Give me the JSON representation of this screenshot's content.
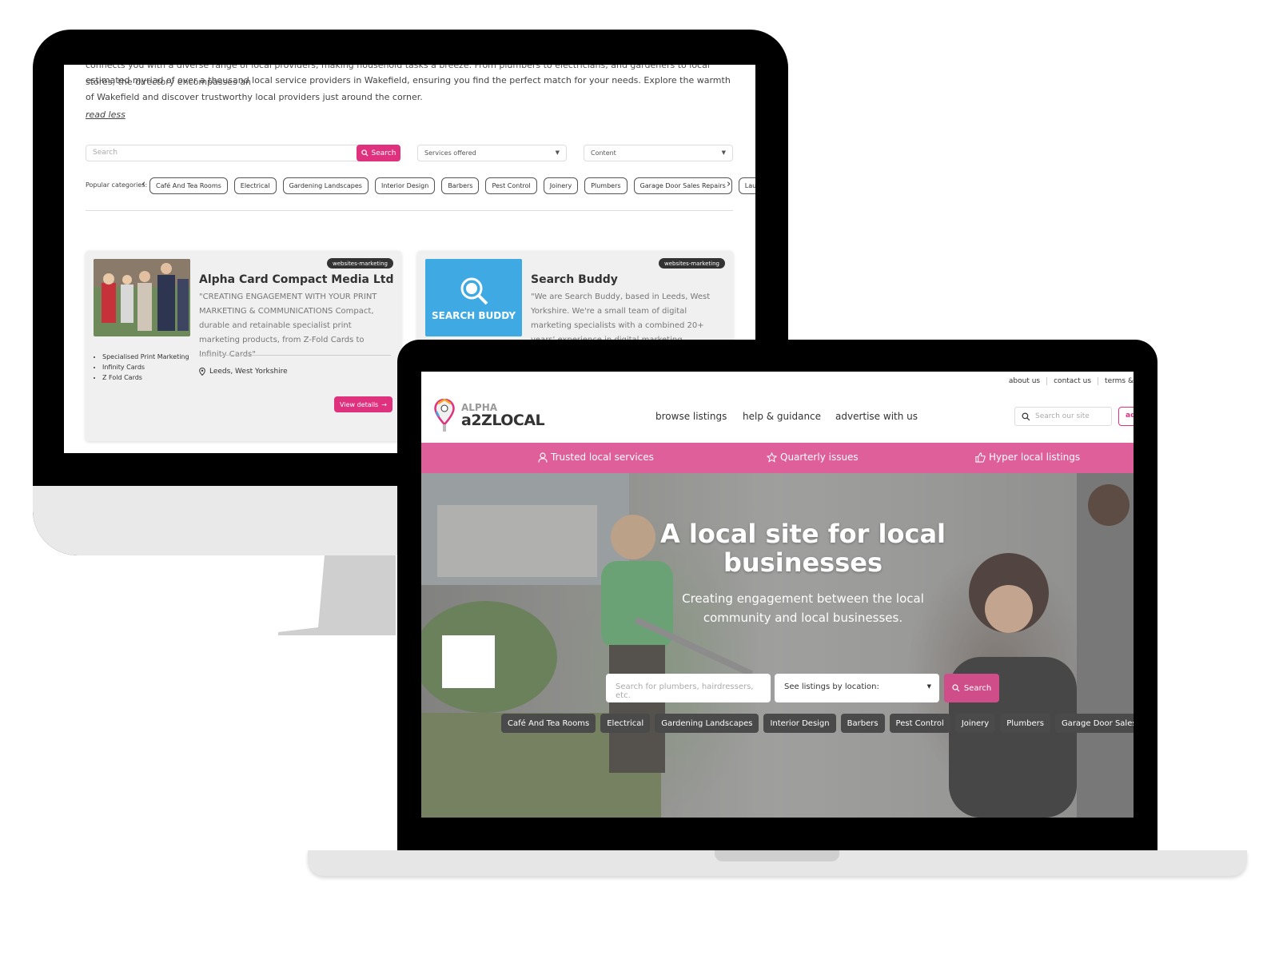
{
  "directory_page": {
    "description_top": "connects you with a diverse range of local providers, making household tasks a breeze. From plumbers to electricians, and gardeners to local stores, the directory encompasses an",
    "description": "estimated myriad of over a thousand local service providers in Wakefield, ensuring you find the perfect match for your needs. Explore the warmth of Wakefield and discover trustworthy local providers just around the corner.",
    "read_less": "read less",
    "search_placeholder": "Search",
    "search_button": "Search",
    "filter_services": "Services offered",
    "filter_content": "Content",
    "popular_label": "Popular categories:",
    "categories": [
      "Café And Tea Rooms",
      "Electrical",
      "Gardening Landscapes",
      "Interior Design",
      "Barbers",
      "Pest Control",
      "Joinery",
      "Plumbers",
      "Garage Door Sales Repairs",
      "Laundry Servi"
    ],
    "listings": [
      {
        "badge": "websites-marketing",
        "title": "Alpha Card Compact Media Ltd",
        "text": "\"CREATING ENGAGEMENT WITH YOUR PRINT MARKETING & COMMUNICATIONS Compact, durable and retainable specialist print marketing products, from Z-Fold Cards to Infinity Cards\"",
        "bullets": [
          "Specialised Print Marketing",
          "Infinity Cards",
          "Z Fold Cards"
        ],
        "location": "Leeds, West Yorkshire",
        "button": "View details"
      },
      {
        "badge": "websites-marketing",
        "title": "Search Buddy",
        "image_label": "SEARCH BUDDY",
        "text": "\"We are Search Buddy, based in Leeds, West Yorkshire. We're a small team of digital marketing specialists with a combined 20+ years' experience in digital marketing."
      }
    ]
  },
  "home_page": {
    "top_links": [
      "about us",
      "contact us",
      "terms &"
    ],
    "logo_small": "ALPHA",
    "logo_big": "a2ZLOCAL",
    "nav": [
      "browse listings",
      "help & guidance",
      "advertise with us"
    ],
    "site_search_placeholder": "Search our site",
    "ad_button": "ad",
    "features": [
      "Trusted local services",
      "Quarterly issues",
      "Hyper local listings"
    ],
    "hero_title": "A local site for local businesses",
    "hero_subtitle": "Creating engagement between the local community and local businesses.",
    "hero_search_placeholder": "Search for plumbers, hairdressers, etc.",
    "location_select": "See listings by location:",
    "hero_search_button": "Search",
    "hero_categories": [
      "Café And Tea Rooms",
      "Electrical",
      "Gardening Landscapes",
      "Interior Design",
      "Barbers",
      "Pest Control",
      "Joinery",
      "Plumbers",
      "Garage Door Sales Repairs"
    ]
  },
  "colors": {
    "accent_pink": "#e0317f",
    "feature_bar": "#df5f9a"
  }
}
